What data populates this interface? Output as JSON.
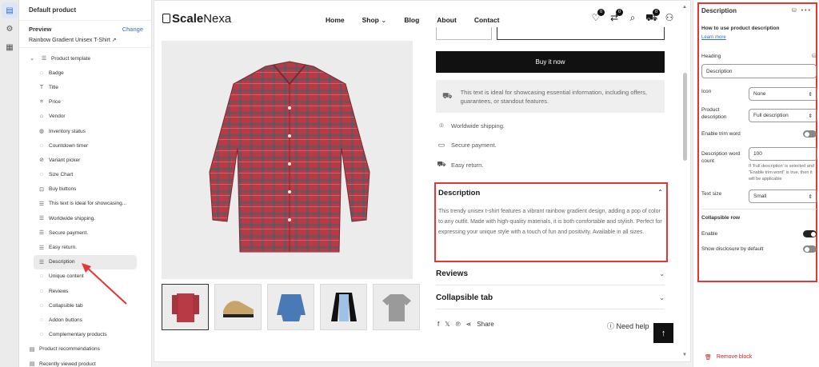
{
  "left": {
    "header": "Default product",
    "preview_label": "Preview",
    "change_label": "Change",
    "product_name": "Rainbow Gradient Unisex T-Shirt",
    "template_label": "Product template",
    "blocks": [
      "Badge",
      "Title",
      "Price",
      "Vendor",
      "Inventory status",
      "Countdown timer",
      "Variant picker",
      "Size Chart",
      "Buy buttons",
      "This text is ideal for showcasing...",
      "Worldwide shipping.",
      "Secure payment.",
      "Easy return.",
      "Description",
      "Unique content",
      "Reviews",
      "Collapsible tab",
      "Addon buttons",
      "Complementary products"
    ],
    "sections": [
      "Product recommendations",
      "Recently viewed product"
    ]
  },
  "store": {
    "logo_bold": "Scale",
    "logo_thin": "Nexa",
    "nav": [
      "Home",
      "Shop",
      "Blog",
      "About",
      "Contact"
    ],
    "wishlist_count": "0",
    "compare_count": "0",
    "cart_count": "0",
    "buy_now": "Buy it now",
    "note_text": "This text is ideal for showcasing essential information, including offers, guarantees, or standout features.",
    "features": [
      "Worldwide shipping.",
      "Secure payment.",
      "Easy return."
    ],
    "description_title": "Description",
    "description_body": "This trendy unisex t-shirt features a vibrant rainbow gradient design, adding a pop of color to any outfit. Made with high-quality materials, it is both comfortable and stylish. Perfect for expressing your unique style with a touch of fun and positivity. Available in all sizes.",
    "accordions": [
      "Reviews",
      "Collapsible tab"
    ],
    "share_label": "Share",
    "help_label": "Need help"
  },
  "panel": {
    "title": "Description",
    "how_to": "How to use product description",
    "learn_more": "Learn more",
    "heading_label": "Heading",
    "heading_value": "Description",
    "icon_label": "Icon",
    "icon_value": "None",
    "product_desc_label": "Product description",
    "product_desc_value": "Full description",
    "trim_label": "Enable trim word",
    "word_count_label": "Description word count",
    "word_count_value": "100",
    "word_count_hint": "If 'Full description' is selected and \"Enable trim word\" is true, then it will be applicable",
    "text_size_label": "Text size",
    "text_size_value": "Small",
    "collapsible_label": "Collapsible row",
    "enable_label": "Enable",
    "disclosure_label": "Show disclosure by default",
    "remove_label": "Remove block"
  },
  "colors": {
    "highlight": "#e53535",
    "shirt": "#b83a45",
    "link": "#2c6ecb"
  }
}
